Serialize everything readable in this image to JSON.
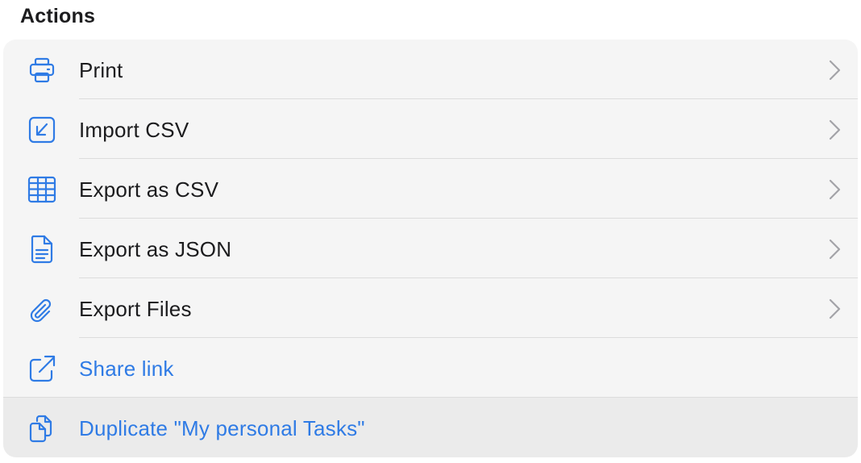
{
  "section": {
    "title": "Actions"
  },
  "colors": {
    "accent": "#2f7be5",
    "text": "#1c1c1e",
    "card_bg": "#f5f5f5",
    "highlight_bg": "#ebebeb",
    "separator": "#dcdcdc"
  },
  "actions": [
    {
      "label": "Print",
      "icon": "printer-icon",
      "chevron": true,
      "style": "default"
    },
    {
      "label": "Import CSV",
      "icon": "import-arrow-icon",
      "chevron": true,
      "style": "default"
    },
    {
      "label": "Export as CSV",
      "icon": "table-grid-icon",
      "chevron": true,
      "style": "default"
    },
    {
      "label": "Export as JSON",
      "icon": "document-icon",
      "chevron": true,
      "style": "default"
    },
    {
      "label": "Export Files",
      "icon": "paperclip-icon",
      "chevron": true,
      "style": "default"
    },
    {
      "label": "Share link",
      "icon": "share-out-icon",
      "chevron": false,
      "style": "link"
    },
    {
      "label": "Duplicate \"My personal Tasks\"",
      "icon": "duplicate-icon",
      "chevron": false,
      "style": "link",
      "highlighted": true
    }
  ]
}
